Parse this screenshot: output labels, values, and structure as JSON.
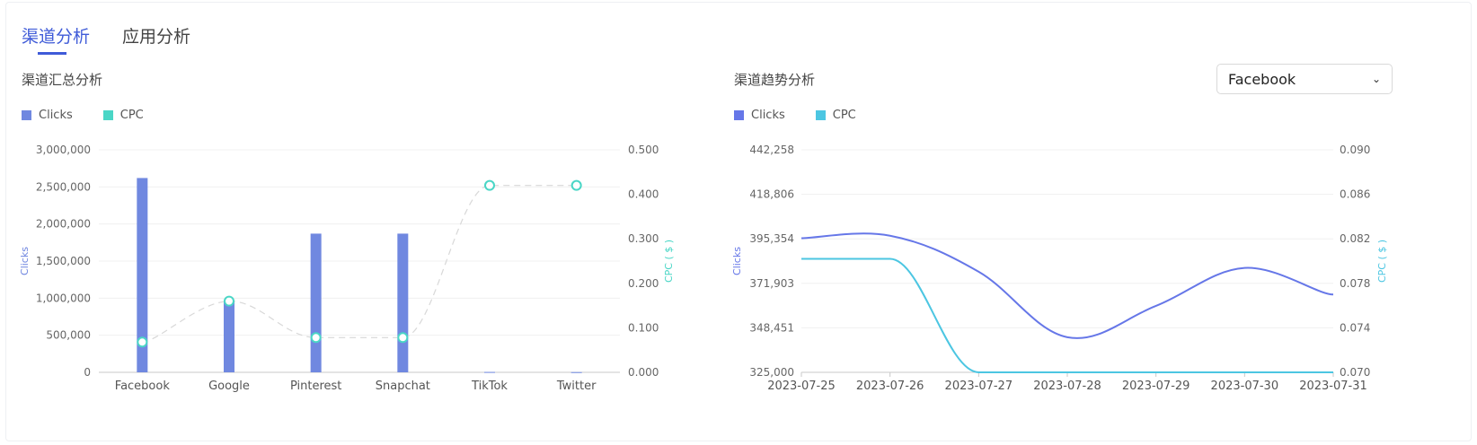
{
  "tabs": [
    {
      "label": "渠道分析",
      "active": true
    },
    {
      "label": "应用分析",
      "active": false
    }
  ],
  "summary": {
    "title": "渠道汇总分析",
    "legend": [
      {
        "label": "Clicks",
        "color": "#7088e0"
      },
      {
        "label": "CPC",
        "color": "#4ad6c6"
      }
    ]
  },
  "trend": {
    "title": "渠道趋势分析",
    "select_value": "Facebook",
    "legend": [
      {
        "label": "Clicks",
        "color": "#6677e8"
      },
      {
        "label": "CPC",
        "color": "#4cc6e2"
      }
    ]
  },
  "chart_data": [
    {
      "type": "bar",
      "categories": [
        "Facebook",
        "Google",
        "Pinterest",
        "Snapchat",
        "TikTok",
        "Twitter"
      ],
      "series": [
        {
          "name": "Clicks",
          "axis": "left",
          "kind": "bar",
          "values": [
            2620000,
            950000,
            1870000,
            1870000,
            5000,
            3000
          ]
        },
        {
          "name": "CPC",
          "axis": "right",
          "kind": "line",
          "values": [
            0.068,
            0.16,
            0.078,
            0.078,
            0.42,
            0.42
          ]
        }
      ],
      "ylabel": "Clicks",
      "y2label": "CPC ( $ )",
      "ylim": [
        0,
        3000000
      ],
      "yticks": [
        "0",
        "500,000",
        "1,000,000",
        "1,500,000",
        "2,000,000",
        "2,500,000",
        "3,000,000"
      ],
      "y2lim": [
        0,
        0.5
      ],
      "y2ticks": [
        "0.000",
        "0.100",
        "0.200",
        "0.300",
        "0.400",
        "0.500"
      ],
      "grid": true
    },
    {
      "type": "line",
      "x": [
        "2023-07-25",
        "2023-07-26",
        "2023-07-27",
        "2023-07-28",
        "2023-07-29",
        "2023-07-30",
        "2023-07-31"
      ],
      "series": [
        {
          "name": "Clicks",
          "axis": "left",
          "values": [
            395700,
            397000,
            378000,
            343500,
            360000,
            380000,
            366000
          ]
        },
        {
          "name": "CPC",
          "axis": "right",
          "values": [
            0.0802,
            0.0802,
            0.07,
            0.07,
            0.07,
            0.07,
            0.07
          ]
        }
      ],
      "ylabel": "Clicks",
      "y2label": "CPC ( $ )",
      "ylim": [
        325000,
        442258
      ],
      "yticks": [
        "325,000",
        "348,451",
        "371,903",
        "395,354",
        "418,806",
        "442,258"
      ],
      "y2lim": [
        0.07,
        0.09
      ],
      "y2ticks": [
        "0.070",
        "0.074",
        "0.078",
        "0.082",
        "0.086",
        "0.090"
      ],
      "grid": true
    }
  ]
}
